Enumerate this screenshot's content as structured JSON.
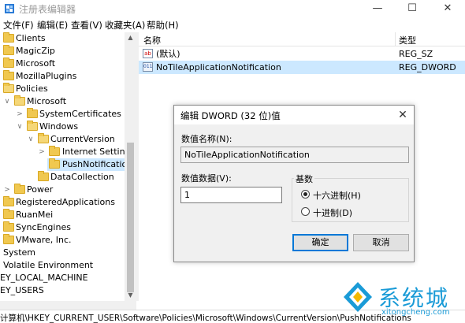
{
  "window": {
    "title": "注册表编辑器",
    "controls": {
      "minimize": "—",
      "maximize": "☐",
      "close": "✕"
    }
  },
  "menu": [
    "文件(F)",
    "编辑(E)",
    "查看(V)",
    "收藏夹(A)",
    "帮助(H)"
  ],
  "tree": {
    "items": [
      {
        "label": "Clients",
        "expander": "",
        "selected": false
      },
      {
        "label": "MagicZip",
        "expander": "",
        "selected": false
      },
      {
        "label": "Microsoft",
        "expander": "",
        "selected": false
      },
      {
        "label": "MozillaPlugins",
        "expander": "",
        "selected": false
      },
      {
        "label": "Policies",
        "expander": "∨",
        "selected": false
      },
      {
        "label": "Microsoft",
        "expander": "∨",
        "selected": false
      },
      {
        "label": "SystemCertificates",
        "expander": ">",
        "selected": false
      },
      {
        "label": "Windows",
        "expander": "∨",
        "selected": false
      },
      {
        "label": "CurrentVersion",
        "expander": "∨",
        "selected": false
      },
      {
        "label": "Internet Settings",
        "expander": ">",
        "selected": false
      },
      {
        "label": "PushNotifications",
        "expander": "",
        "selected": true
      },
      {
        "label": "DataCollection",
        "expander": "",
        "selected": false
      },
      {
        "label": "Power",
        "expander": ">",
        "selected": false
      },
      {
        "label": "RegisteredApplications",
        "expander": "",
        "selected": false
      },
      {
        "label": "RuanMei",
        "expander": "",
        "selected": false
      },
      {
        "label": "SyncEngines",
        "expander": "",
        "selected": false
      },
      {
        "label": "VMware, Inc.",
        "expander": "",
        "selected": false
      },
      {
        "label": "System",
        "expander": "",
        "selected": false
      },
      {
        "label": "Volatile Environment",
        "expander": "",
        "selected": false
      },
      {
        "label": "EY_LOCAL_MACHINE",
        "expander": "",
        "selected": false
      },
      {
        "label": "EY_USERS",
        "expander": "",
        "selected": false
      }
    ]
  },
  "list": {
    "headers": {
      "name": "名称",
      "type": "类型"
    },
    "rows": [
      {
        "icon": "string-value-icon",
        "icon_text": "ab",
        "name": "(默认)",
        "type": "REG_SZ",
        "selected": false
      },
      {
        "icon": "binary-value-icon",
        "icon_text": "011",
        "name": "NoTileApplicationNotification",
        "type": "REG_DWORD",
        "selected": true
      }
    ]
  },
  "status": {
    "path": "计算机\\HKEY_CURRENT_USER\\Software\\Policies\\Microsoft\\Windows\\CurrentVersion\\PushNotifications"
  },
  "dialog": {
    "title": "编辑 DWORD (32 位)值",
    "close": "✕",
    "value_name_label": "数值名称(N):",
    "value_name": "NoTileApplicationNotification",
    "value_data_label": "数值数据(V):",
    "value_data": "1",
    "base_label": "基数",
    "base_hex": "十六进制(H)",
    "base_dec": "十进制(D)",
    "base_selected": "hex",
    "ok": "确定",
    "cancel": "取消"
  },
  "watermark": {
    "text": "系统城",
    "url": "xitongcheng.com"
  },
  "colors": {
    "selection": "#cce8ff",
    "accent": "#0078d7",
    "watermark": "#1a9bd7",
    "folder": "#f0c850"
  }
}
